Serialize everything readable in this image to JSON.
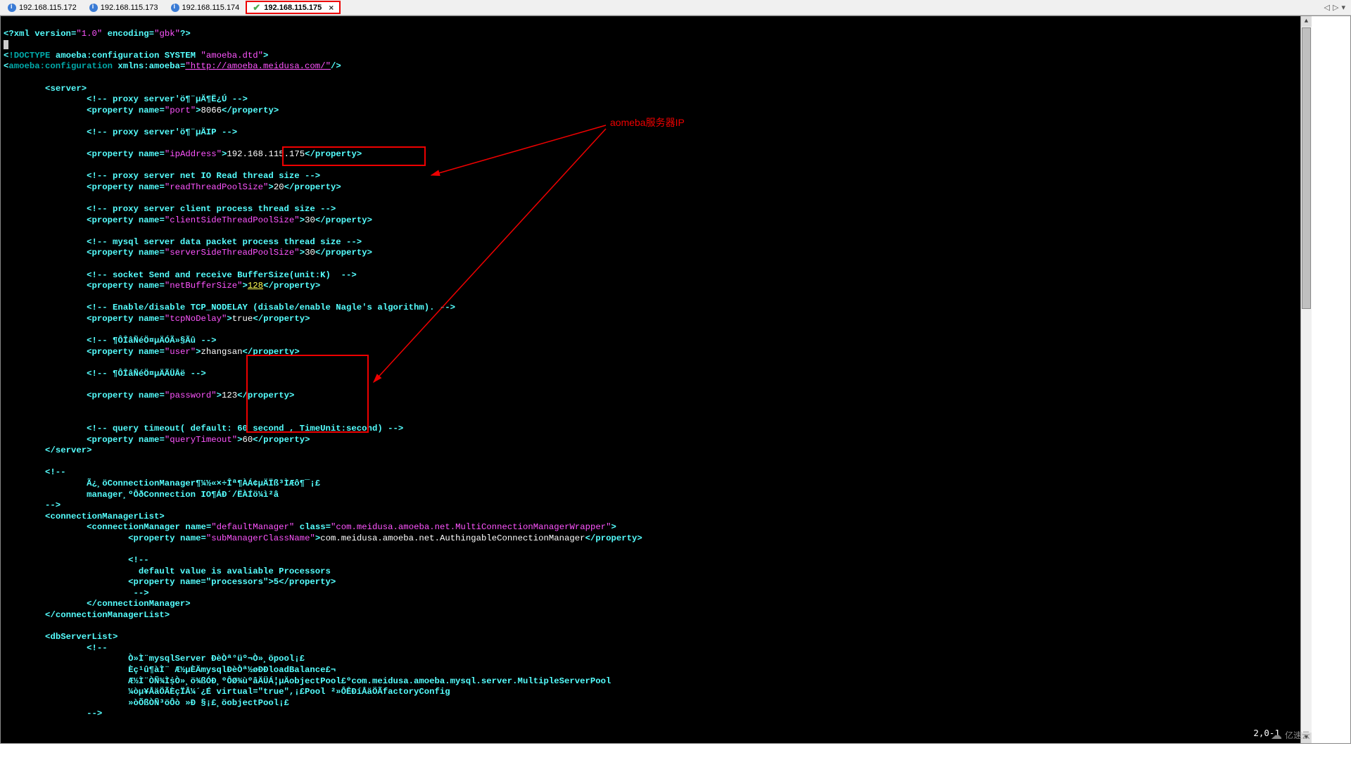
{
  "tabs": {
    "t0": "192.168.115.172",
    "t1": "192.168.115.173",
    "t2": "192.168.115.174",
    "t3": "192.168.115.175",
    "close": "×"
  },
  "nav": {
    "prev": "◁",
    "next": "▷",
    "menu": "▾"
  },
  "anno": {
    "label": "aomeba服务器IP"
  },
  "status": {
    "pos": "2,0-1"
  },
  "watermark": {
    "text": "亿速云"
  },
  "xml": {
    "decl_open": "<?xml ",
    "ver_k": "version",
    "ver_v": "\"1.0\"",
    "enc_k": "encoding",
    "enc_v": "\"gbk\"",
    "decl_close": "?>",
    "doctype": "!DOCTYPE",
    "doctype_rest": " amoeba:configuration SYSTEM ",
    "doctype_dtd": "\"amoeba.dtd\"",
    "root_open": "amoeba:configuration",
    "xmlns_k": "xmlns:amoeba",
    "xmlns_v": "\"http://amoeba.meidusa.com/\"",
    "server": "server",
    "c1": "<!-- proxy server'ö¶¨µÄ¶Ë¿Ú -->",
    "prop": "property",
    "name": "name",
    "k_port": "\"port\"",
    "v_port": "8066",
    "c2": "<!-- proxy server'ö¶¨µÄIP -->",
    "k_ip": "\"ipAddress\"",
    "v_ip": "192.168.115.175",
    "c3": "<!-- proxy server net IO Read thread size -->",
    "k_read": "\"readThreadPoolSize\"",
    "v_read": "20",
    "c4": "<!-- proxy server client process thread size -->",
    "k_client": "\"clientSideThreadPoolSize\"",
    "v_client": "30",
    "c5": "<!-- mysql server data packet process thread size -->",
    "k_server": "\"serverSideThreadPoolSize\"",
    "v_server": "30",
    "c6": "<!-- socket Send and receive BufferSize(unit:K)  -->",
    "k_buf": "\"netBufferSize\"",
    "v_buf": "128",
    "c7": "<!-- Enable/disable TCP_NODELAY (disable/enable Nagle's algorithm). -->",
    "k_nodelay": "\"tcpNoDelay\"",
    "v_nodelay": "true",
    "c8": "<!-- ¶ÔÎâÑéÖ¤µÄÓÃ»§Ãû -->",
    "k_user": "\"user\"",
    "v_user": "zhangsan",
    "c9": "<!-- ¶ÔÎâÑéÖ¤µÄÃÜÂë -->",
    "k_pass": "\"password\"",
    "v_pass": "123",
    "c10": "<!-- query timeout( default: 60 second , TimeUnit:second) -->",
    "k_qt": "\"queryTimeout\"",
    "v_qt": "60",
    "server_close": "/server",
    "cm_c1": "<!--",
    "cm_c2": "Ã¿¸öConnectionManager¶¼½«×÷Îª¶ÀÁ¢µÄÏß³ÌÆô¶¯¡£",
    "cm_c3": "manager¸ºÔðConnection IO¶ÁÐ´/ËÀÍö¼ì²â",
    "cm_c4": "-->",
    "cml": "connectionManagerList",
    "cm": "connectionManager",
    "k_cmname": "\"defaultManager\"",
    "k_class": "class",
    "v_class": "\"com.meidusa.amoeba.net.MultiConnectionManagerWrapper\"",
    "k_sub": "\"subManagerClassName\"",
    "v_sub": "com.meidusa.amoeba.net.AuthingableConnectionManager",
    "cm_inner1": "<!--",
    "cm_inner2": "  default value is avaliable Processors",
    "cm_inner3": "<property name=\"processors\">5</property>",
    "cm_inner4": " -->",
    "cm_close": "/connectionManager",
    "cml_close": "/connectionManagerList",
    "dbl": "dbServerList",
    "db_c1": "<!--",
    "db_c2": "Ò»Ì¨mysqlServer ÐèÒª°üº¬Ò»¸öpool¡£",
    "db_c3": "Èç¹û¶àÌ¨ Æ½µÈÄmysqlÐèÒª½øÐÐloadBalance£¬",
    "db_c4": "Æ½Ì¨ÒÑ¾­ÌṩÒ»¸ö¾ßÓÐ¸ºÔØ¾ùºâÄÜÁ¦µÄobjectPool£ºcom.meidusa.amoeba.mysql.server.MultipleServerPool",
    "db_c5": "¼òµ¥ÅäÖÃÈçÏÂ¼´¿É virtual=\"true\",¡£Pool ²»ÔÊÐíÅäÖÃfactoryConfig",
    "db_c6": "»òÕßÒÑ³öÔò »Ð §¡£¸öobjectPool¡£",
    "db_c7": "-->"
  }
}
